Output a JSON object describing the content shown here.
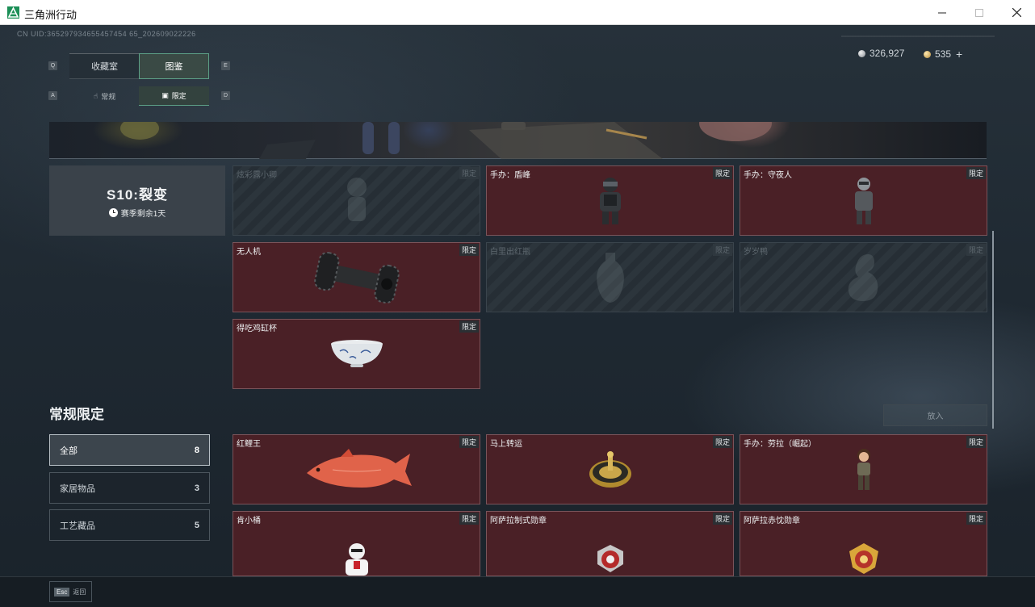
{
  "window": {
    "title": "三角洲行动"
  },
  "header": {
    "uid": "CN UID:365297934655457454 65_202609022226",
    "currency_silver": "326,927",
    "currency_gold": "535",
    "add_label": "+"
  },
  "tabs": {
    "key_prev": "Q",
    "key_next": "E",
    "main": [
      {
        "label": "收藏室",
        "active": false
      },
      {
        "label": "图鉴",
        "active": true
      }
    ],
    "sub_key_prev": "A",
    "sub_key_next": "D",
    "sub": [
      {
        "label": "常规",
        "active": false
      },
      {
        "label": "限定",
        "active": true
      }
    ]
  },
  "season": {
    "title": "S10:裂变",
    "remaining": "赛季剩余1天"
  },
  "season_items": [
    {
      "name": "炫彩露小卿",
      "tag": "限定",
      "locked": true,
      "art": "figure-icon"
    },
    {
      "name": "手办：盾峰",
      "tag": "限定",
      "locked": false,
      "art": "armored-figure-icon"
    },
    {
      "name": "手办：守夜人",
      "tag": "限定",
      "locked": false,
      "art": "soldier-figure-icon"
    },
    {
      "name": "无人机",
      "tag": "限定",
      "locked": false,
      "art": "drone-icon"
    },
    {
      "name": "白里出红瓶",
      "tag": "限定",
      "locked": true,
      "art": "vase-icon"
    },
    {
      "name": "岁岁鸭",
      "tag": "限定",
      "locked": true,
      "art": "duck-icon"
    },
    {
      "name": "得吃鸡缸杯",
      "tag": "限定",
      "locked": false,
      "art": "bowl-icon"
    }
  ],
  "regular": {
    "title": "常规限定",
    "drop_label": "放入",
    "categories": [
      {
        "label": "全部",
        "count": "8",
        "active": true
      },
      {
        "label": "家居物品",
        "count": "3",
        "active": false
      },
      {
        "label": "工艺藏品",
        "count": "5",
        "active": false
      }
    ],
    "items": [
      {
        "name": "红鲤王",
        "tag": "限定",
        "art": "carp-icon"
      },
      {
        "name": "马上转运",
        "tag": "限定",
        "art": "compass-icon"
      },
      {
        "name": "手办：劳拉（崛起）",
        "tag": "限定",
        "art": "lara-figure-icon"
      },
      {
        "name": "肯小桶",
        "tag": "限定",
        "art": "colonel-figure-icon"
      },
      {
        "name": "阿萨拉制式勋章",
        "tag": "限定",
        "art": "medal-red-icon"
      },
      {
        "name": "阿萨拉赤忱勋章",
        "tag": "限定",
        "art": "medal-gold-icon"
      }
    ]
  },
  "footer": {
    "esc_key": "Esc",
    "back_label": "返回"
  }
}
